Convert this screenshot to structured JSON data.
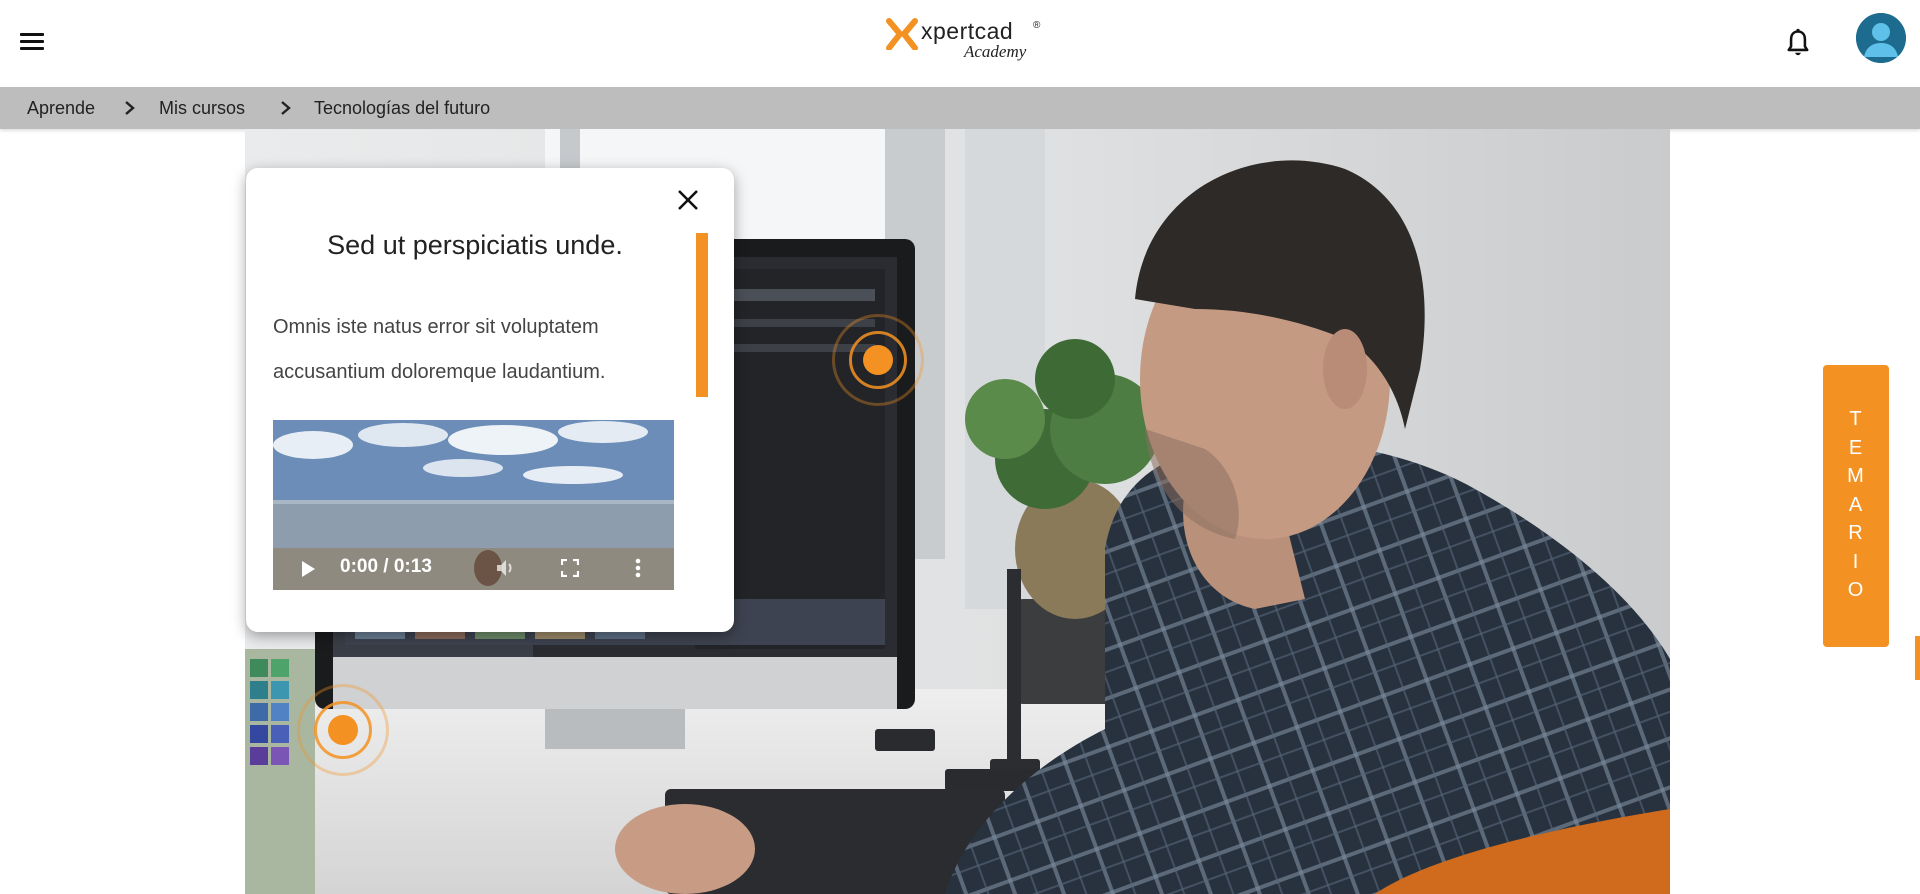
{
  "header": {
    "menu_icon": "hamburger-menu-icon",
    "logo": {
      "word": "xpertcad",
      "reg": "®",
      "sub": "Academy",
      "accent": "#f39222"
    },
    "bell_icon": "bell-icon",
    "avatar_icon": "user-avatar-icon"
  },
  "breadcrumb": {
    "items": [
      "Aprende",
      "Mis cursos",
      "Tecnologías del futuro"
    ],
    "separator_icon": "chevron-right-icon"
  },
  "popup": {
    "title": "Sed ut perspiciatis unde.",
    "text": "Omnis iste natus error sit voluptatem accusantium doloremque laudantium.",
    "close_icon": "close-icon",
    "video": {
      "time": "0:00 / 0:13",
      "play_icon": "play-icon",
      "volume_icon": "volume-icon",
      "fullscreen_icon": "fullscreen-icon",
      "more_icon": "more-vertical-icon"
    }
  },
  "side_tab": {
    "label": "TEMARIO",
    "color": "#f39222"
  },
  "hotspots": [
    "hotspot-icon",
    "hotspot-icon"
  ]
}
